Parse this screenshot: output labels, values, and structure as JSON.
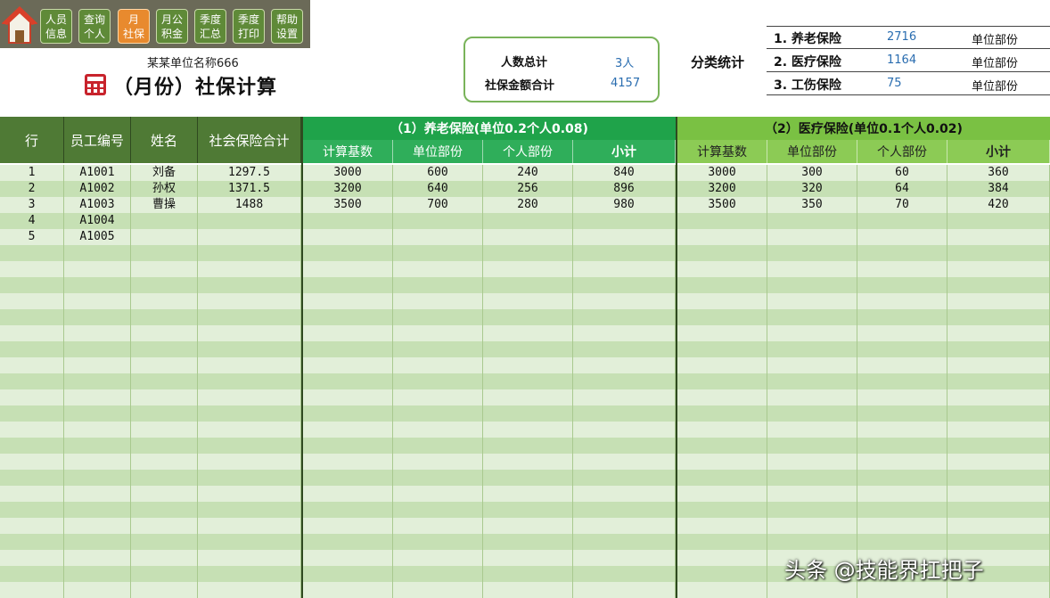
{
  "nav": {
    "items": [
      {
        "l1": "人员",
        "l2": "信息",
        "active": false
      },
      {
        "l1": "查询",
        "l2": "个人",
        "active": false
      },
      {
        "l1": "月",
        "l2": "社保",
        "active": true
      },
      {
        "l1": "月公",
        "l2": "积金",
        "active": false
      },
      {
        "l1": "季度",
        "l2": "汇总",
        "active": false
      },
      {
        "l1": "季度",
        "l2": "打印",
        "active": false
      },
      {
        "l1": "帮助",
        "l2": "设置",
        "active": false
      }
    ]
  },
  "header": {
    "unit_name": "某某单位名称666",
    "title": "（月份）社保计算"
  },
  "summary": {
    "count_label": "人数总计",
    "count_value": "3人",
    "amount_label": "社保金额合计",
    "amount_value": "4157"
  },
  "category": {
    "label": "分类统计",
    "rows": [
      {
        "name": "1. 养老保险",
        "value": "2716",
        "unit": "单位部份"
      },
      {
        "name": "2. 医疗保险",
        "value": "1164",
        "unit": "单位部份"
      },
      {
        "name": "3. 工伤保险",
        "value": "75",
        "unit": "单位部份"
      }
    ]
  },
  "table": {
    "col_row": "行",
    "col_id": "员工编号",
    "col_name": "姓名",
    "col_total": "社会保险合计",
    "group1": "（1）养老保险(单位0.2个人0.08)",
    "group2": "（2）医疗保险(单位0.1个人0.02)",
    "sub": [
      "计算基数",
      "单位部份",
      "个人部份",
      "小计"
    ],
    "rows": [
      {
        "r": "1",
        "id": "A1001",
        "name": "刘备",
        "total": "1297.5",
        "g1": [
          "3000",
          "600",
          "240",
          "840"
        ],
        "g2": [
          "3000",
          "300",
          "60",
          "360"
        ]
      },
      {
        "r": "2",
        "id": "A1002",
        "name": "孙权",
        "total": "1371.5",
        "g1": [
          "3200",
          "640",
          "256",
          "896"
        ],
        "g2": [
          "3200",
          "320",
          "64",
          "384"
        ]
      },
      {
        "r": "3",
        "id": "A1003",
        "name": "曹操",
        "total": "1488",
        "g1": [
          "3500",
          "700",
          "280",
          "980"
        ],
        "g2": [
          "3500",
          "350",
          "70",
          "420"
        ]
      },
      {
        "r": "4",
        "id": "A1004",
        "name": "",
        "total": "",
        "g1": [
          "",
          "",
          "",
          ""
        ],
        "g2": [
          "",
          "",
          "",
          ""
        ]
      },
      {
        "r": "5",
        "id": "A1005",
        "name": "",
        "total": "",
        "g1": [
          "",
          "",
          "",
          ""
        ],
        "g2": [
          "",
          "",
          "",
          ""
        ]
      }
    ],
    "empty_rows": 22
  },
  "watermark": "头条 @技能界扛把子",
  "colors": {
    "accent_orange": "#e88a2e",
    "nav_green": "#5f8a38",
    "header_dark": "#4f7a35",
    "group1": "#1fa34a",
    "group2": "#7ac143",
    "row_light": "#e2efd9",
    "row_dark": "#c6e0b4",
    "value_blue": "#2a6db0"
  }
}
